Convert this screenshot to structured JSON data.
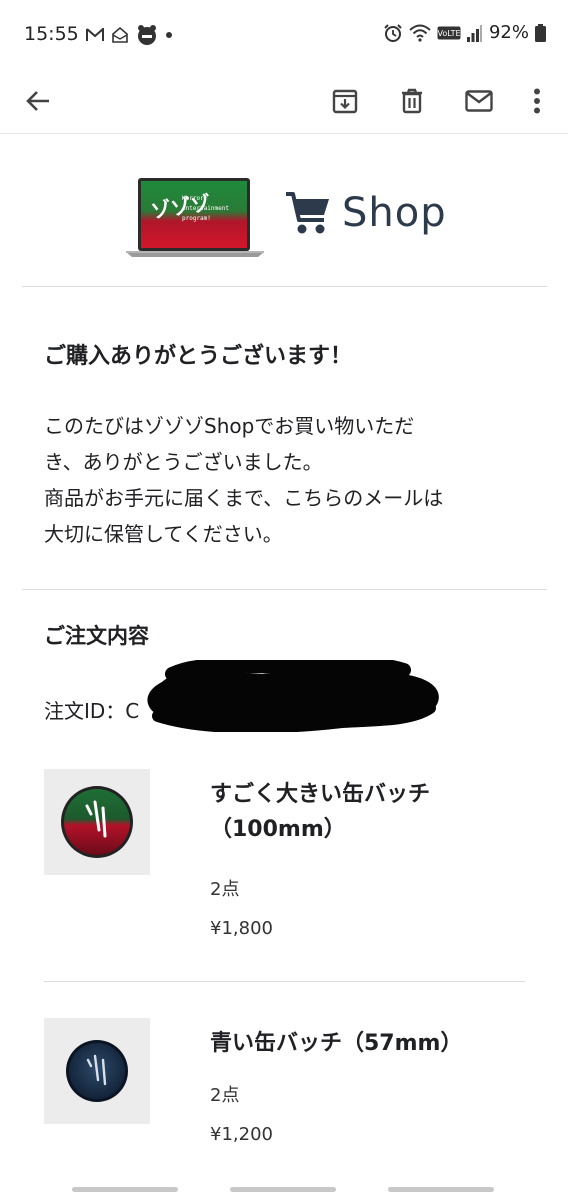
{
  "status": {
    "time": "15:55",
    "battery": "92%",
    "left_icons": [
      "gmail-icon",
      "notification-icon",
      "app-icon",
      "dot-icon"
    ],
    "right_icons": [
      "alarm-icon",
      "wifi-icon",
      "volte-icon",
      "signal-icon",
      "battery-icon"
    ]
  },
  "toolbar": {
    "back": "back-arrow-icon",
    "actions": [
      "archive-icon",
      "delete-icon",
      "mark-unread-icon",
      "more-options-icon"
    ]
  },
  "logo": {
    "laptop_text_main": "ゾゾゾ",
    "laptop_text_sub": [
      "Horror",
      "entertainment",
      "program!"
    ],
    "shop": "Shop",
    "colors": {
      "green": "#1e8a3c",
      "red": "#d2162b",
      "navy": "#2c3a4b"
    }
  },
  "thanks": {
    "title": "ご購入ありがとうございます！",
    "line1": "このたびはゾゾゾShopでお買い物いただ",
    "line2": "き、ありがとうございました。",
    "line3": "商品がお手元に届くまで、こちらのメールは",
    "line4": "大切に保管してください。"
  },
  "order": {
    "heading": "ご注文内容",
    "id_label": "注文ID：C",
    "items": [
      {
        "name_line1": "すごく大きい缶バッチ",
        "name_line2": "（100mm）",
        "qty": "2点",
        "price": "¥1,800"
      },
      {
        "name_line1": "青い缶バッチ（57mm）",
        "qty": "2点",
        "price": "¥1,200"
      }
    ]
  }
}
